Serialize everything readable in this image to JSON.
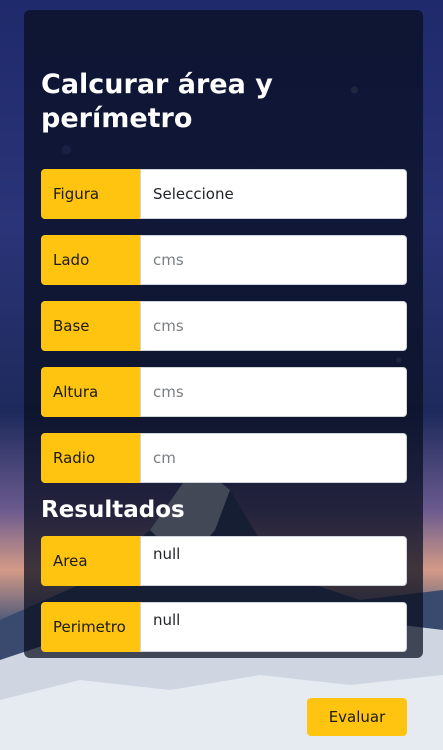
{
  "form": {
    "title": "Calcurar área y perímetro",
    "figure": {
      "label": "Figura",
      "value": "Seleccione"
    },
    "lado": {
      "label": "Lado",
      "placeholder": "cms"
    },
    "base": {
      "label": "Base",
      "placeholder": "cms"
    },
    "altura": {
      "label": "Altura",
      "placeholder": "cms"
    },
    "radio": {
      "label": "Radio",
      "placeholder": "cm"
    }
  },
  "results": {
    "heading": "Resultados",
    "area": {
      "label": "Area",
      "value": "null"
    },
    "perimetro": {
      "label": "Perimetro",
      "value": "null"
    }
  },
  "actions": {
    "evaluate_label": "Evaluar"
  },
  "colors": {
    "accent": "#ffc410",
    "card": "#080e1e"
  }
}
